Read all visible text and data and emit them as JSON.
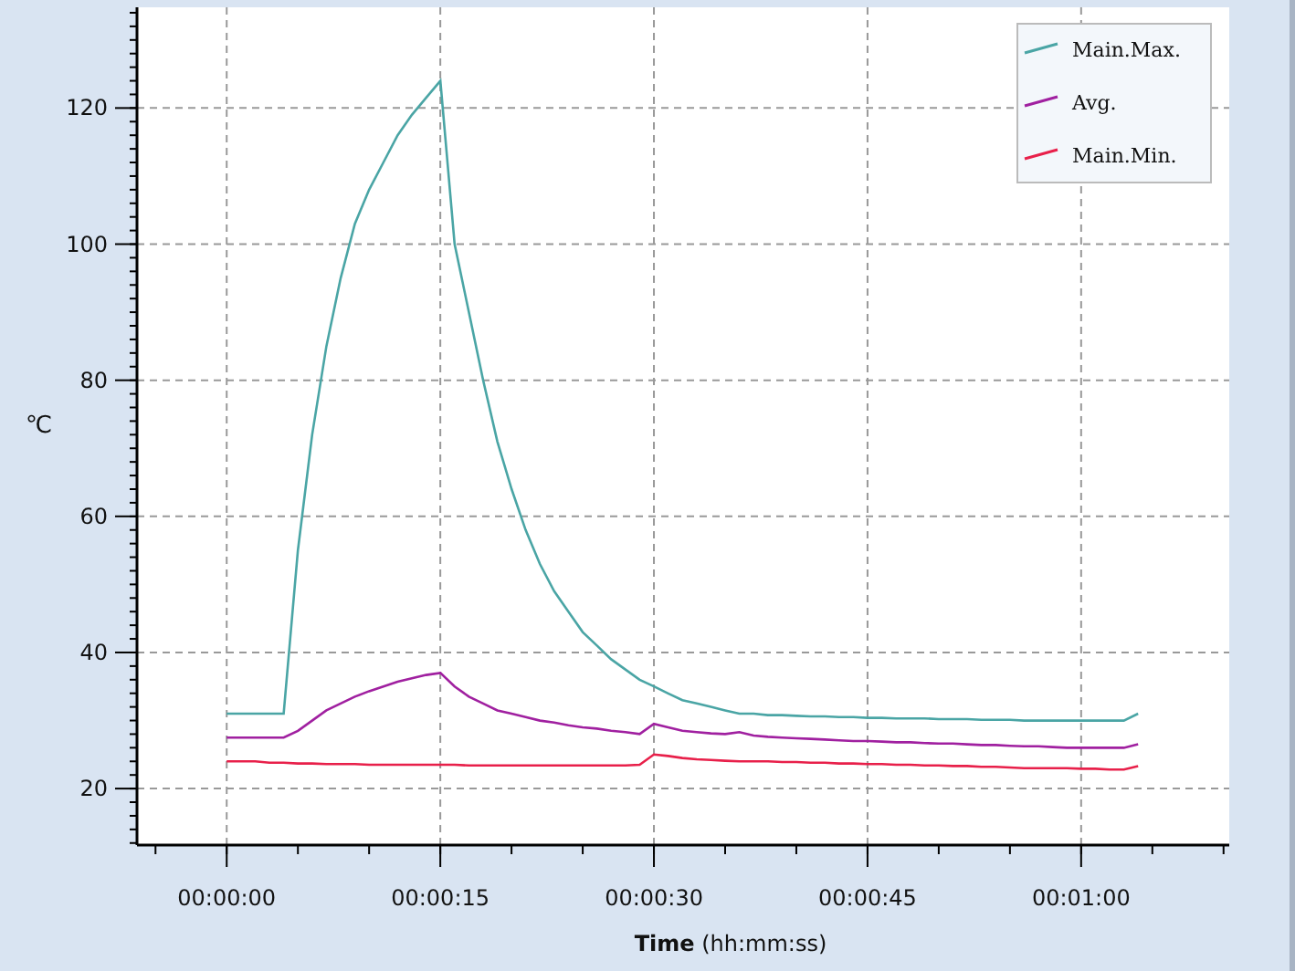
{
  "chart_data": {
    "type": "line",
    "xlabel": "**Time** (hh:mm:ss)",
    "ylabel": "℃",
    "x": [
      0,
      1,
      2,
      3,
      4,
      5,
      6,
      7,
      8,
      9,
      10,
      11,
      12,
      13,
      14,
      15,
      16,
      17,
      18,
      19,
      20,
      21,
      22,
      23,
      24,
      25,
      26,
      27,
      28,
      29,
      30,
      31,
      32,
      33,
      34,
      35,
      36,
      37,
      38,
      39,
      40,
      41,
      42,
      43,
      44,
      45,
      46,
      47,
      48,
      49,
      50,
      51,
      52,
      53,
      54,
      55,
      56,
      57,
      58,
      59,
      60,
      61,
      62,
      63,
      64
    ],
    "series": [
      {
        "name": "Main.Max.",
        "color": "#4aa5a5",
        "values": [
          31,
          31,
          31,
          31,
          31,
          55,
          72,
          85,
          95,
          103,
          108,
          112,
          116,
          119,
          121.5,
          124,
          100,
          90,
          80,
          71,
          64,
          58,
          53,
          49,
          46,
          43,
          41,
          39,
          37.5,
          36,
          35,
          34,
          33,
          32.5,
          32,
          31.5,
          31,
          31,
          30.8,
          30.8,
          30.7,
          30.6,
          30.6,
          30.5,
          30.5,
          30.4,
          30.4,
          30.3,
          30.3,
          30.3,
          30.2,
          30.2,
          30.2,
          30.1,
          30.1,
          30.1,
          30,
          30,
          30,
          30,
          30,
          30,
          30,
          30,
          31
        ]
      },
      {
        "name": "Avg.",
        "color": "#a020a0",
        "values": [
          27.5,
          27.5,
          27.5,
          27.5,
          27.5,
          28.5,
          30,
          31.5,
          32.5,
          33.5,
          34.3,
          35,
          35.7,
          36.2,
          36.7,
          37,
          35,
          33.5,
          32.5,
          31.5,
          31,
          30.5,
          30,
          29.7,
          29.3,
          29,
          28.8,
          28.5,
          28.3,
          28,
          29.5,
          29,
          28.5,
          28.3,
          28.1,
          28,
          28.3,
          27.8,
          27.6,
          27.5,
          27.4,
          27.3,
          27.2,
          27.1,
          27,
          27,
          26.9,
          26.8,
          26.8,
          26.7,
          26.6,
          26.6,
          26.5,
          26.4,
          26.4,
          26.3,
          26.2,
          26.2,
          26.1,
          26,
          26,
          26,
          26,
          26,
          26.5
        ]
      },
      {
        "name": "Main.Min.",
        "color": "#e8204a",
        "values": [
          24,
          24,
          24,
          23.8,
          23.8,
          23.7,
          23.7,
          23.6,
          23.6,
          23.6,
          23.5,
          23.5,
          23.5,
          23.5,
          23.5,
          23.5,
          23.5,
          23.4,
          23.4,
          23.4,
          23.4,
          23.4,
          23.4,
          23.4,
          23.4,
          23.4,
          23.4,
          23.4,
          23.4,
          23.5,
          25,
          24.8,
          24.5,
          24.3,
          24.2,
          24.1,
          24,
          24,
          24,
          23.9,
          23.9,
          23.8,
          23.8,
          23.7,
          23.7,
          23.6,
          23.6,
          23.5,
          23.5,
          23.4,
          23.4,
          23.3,
          23.3,
          23.2,
          23.2,
          23.1,
          23,
          23,
          23,
          23,
          22.9,
          22.9,
          22.8,
          22.8,
          23.3
        ]
      }
    ],
    "xlim": [
      -6.3,
      70.4
    ],
    "ylim": [
      11.7,
      134.8
    ],
    "xticks": [
      {
        "value": 0,
        "label": "00:00:00"
      },
      {
        "value": 15,
        "label": "00:00:15"
      },
      {
        "value": 30,
        "label": "00:00:30"
      },
      {
        "value": 45,
        "label": "00:00:45"
      },
      {
        "value": 60,
        "label": "00:01:00"
      }
    ],
    "yticks": [
      20,
      40,
      60,
      80,
      100,
      120
    ],
    "grid": true,
    "legend": true
  }
}
